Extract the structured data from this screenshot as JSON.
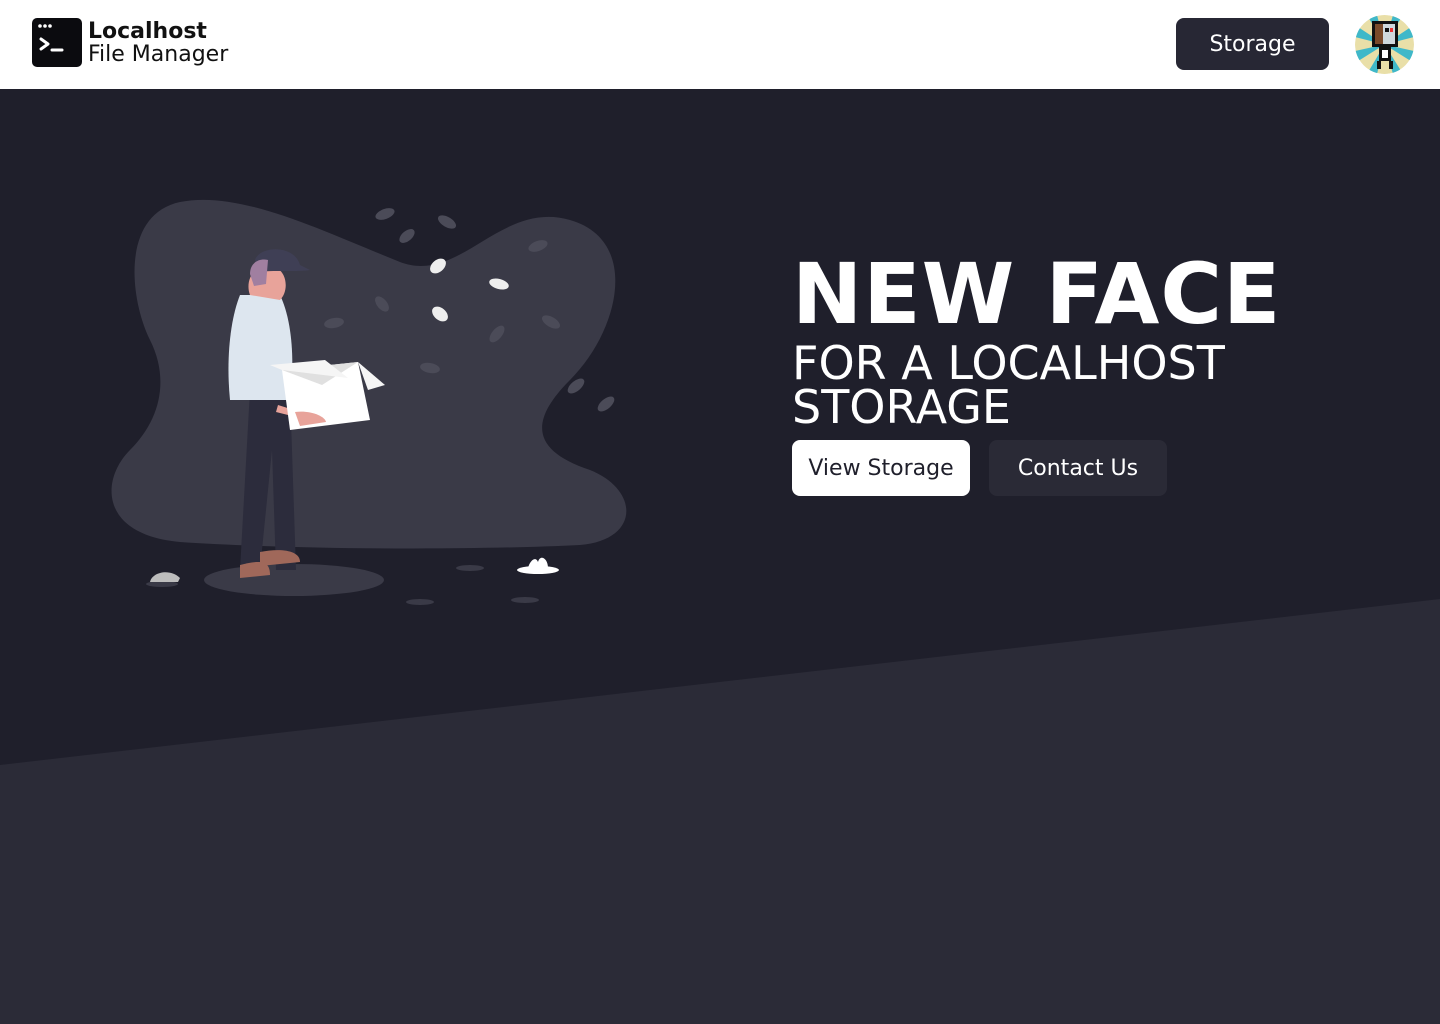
{
  "navbar": {
    "logo_icon": "terminal-icon",
    "logo_line1": "Localhost",
    "logo_line2": "File Manager",
    "storage_label": "Storage",
    "avatar_icon": "pixel-avatar"
  },
  "hero": {
    "headline": "NEW FACE",
    "subheadline_line1": "FOR A LOCALHOST",
    "subheadline_line2": "STORAGE",
    "view_storage_label": "View Storage",
    "contact_label": "Contact Us",
    "illustration": "person-holding-box-illustration"
  },
  "colors": {
    "background_dark": "#1f1f2b",
    "background_lower": "#2b2b37",
    "button_dark": "#272734",
    "accent_white": "#ffffff"
  }
}
